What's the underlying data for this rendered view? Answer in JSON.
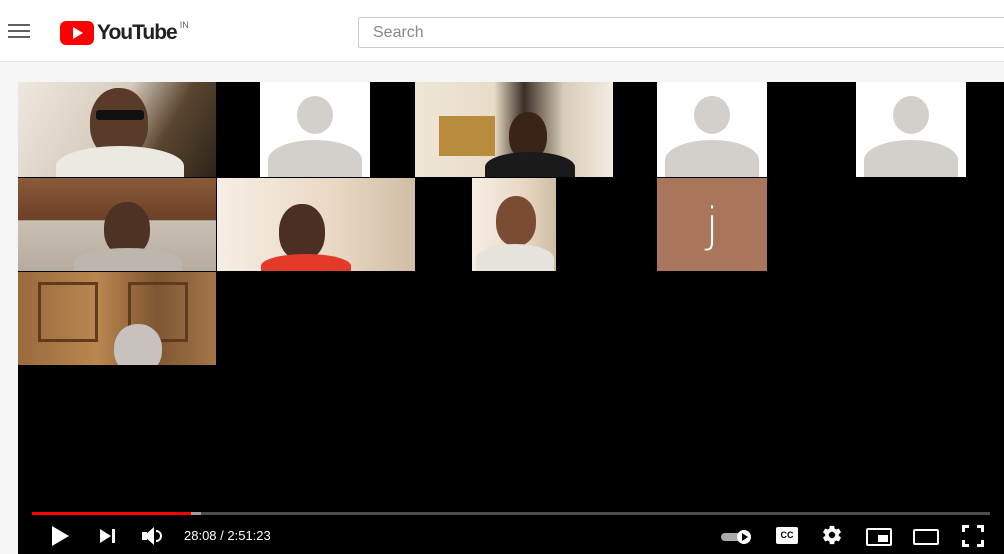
{
  "header": {
    "logo_text": "YouTube",
    "country_code": "IN",
    "search_placeholder": "Search"
  },
  "player": {
    "tiles": [
      {
        "type": "video",
        "participant": "participant-1"
      },
      {
        "type": "placeholder"
      },
      {
        "type": "video",
        "participant": "participant-2"
      },
      {
        "type": "placeholder"
      },
      {
        "type": "placeholder"
      },
      {
        "type": "video",
        "participant": "participant-3"
      },
      {
        "type": "video",
        "participant": "participant-4"
      },
      {
        "type": "video",
        "participant": "participant-5"
      },
      {
        "type": "initial",
        "initial": "j"
      },
      {
        "type": "video",
        "participant": "participant-6"
      }
    ],
    "progress": {
      "played_fraction": 0.166,
      "buffered_fraction": 0.176
    },
    "time_display": "28:08 / 2:51:23",
    "controls": {
      "cc_label": "CC",
      "icons": [
        "play-icon",
        "next-icon",
        "volume-icon",
        "autoplay-toggle-icon",
        "captions-icon",
        "settings-icon",
        "miniplayer-icon",
        "theater-icon",
        "fullscreen-icon"
      ]
    },
    "colors": {
      "progress": "#ff0000",
      "brand": "#ff0000",
      "initial_tile": "#a9765c",
      "placeholder_avatar": "#d3d0cb"
    }
  }
}
